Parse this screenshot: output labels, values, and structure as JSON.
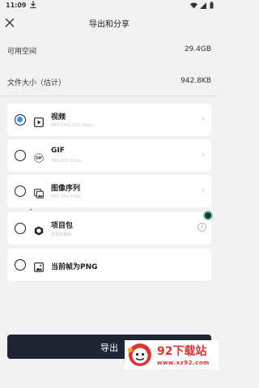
{
  "status_bar": {
    "time": "11:09",
    "icons": [
      "download-icon",
      "wifi-icon",
      "cellular-icon",
      "battery-icon"
    ]
  },
  "header": {
    "title": "导出和分享",
    "close_icon": "close-icon"
  },
  "info": {
    "available_space_label": "可用空间",
    "available_space_value": "29.4GB",
    "file_size_label": "文件大小（估计）",
    "file_size_value": "942.8KB"
  },
  "formats": [
    {
      "label": "视频",
      "sub": "MP4 540p 100 30fps",
      "icon": "video-file-icon",
      "selected": true,
      "trailing": "chevron-right-icon"
    },
    {
      "label": "GIF",
      "sub": "180x320 15fps",
      "icon": "gif-icon",
      "selected": false,
      "trailing": "chevron-right-icon"
    },
    {
      "label": "图像序列",
      "sub": "PNG 56p 15fps",
      "icon": "image-sequence-icon",
      "selected": false,
      "trailing": "chevron-right-icon"
    },
    {
      "label": "项目包",
      "sub": "无预览编辑",
      "icon": "package-icon",
      "selected": false,
      "trailing": "info-icon"
    },
    {
      "label": "当前帧为PNG",
      "sub": "",
      "icon": "image-icon",
      "selected": false,
      "trailing": ""
    }
  ],
  "export_button": {
    "label": "导出"
  },
  "watermark": {
    "title": "92下载站",
    "url": "www.xz92.com"
  },
  "colors": {
    "accent": "#2e9bf0",
    "button_bg": "#1f2535",
    "watermark_red": "#e03330",
    "background": "#f2f2f4"
  }
}
